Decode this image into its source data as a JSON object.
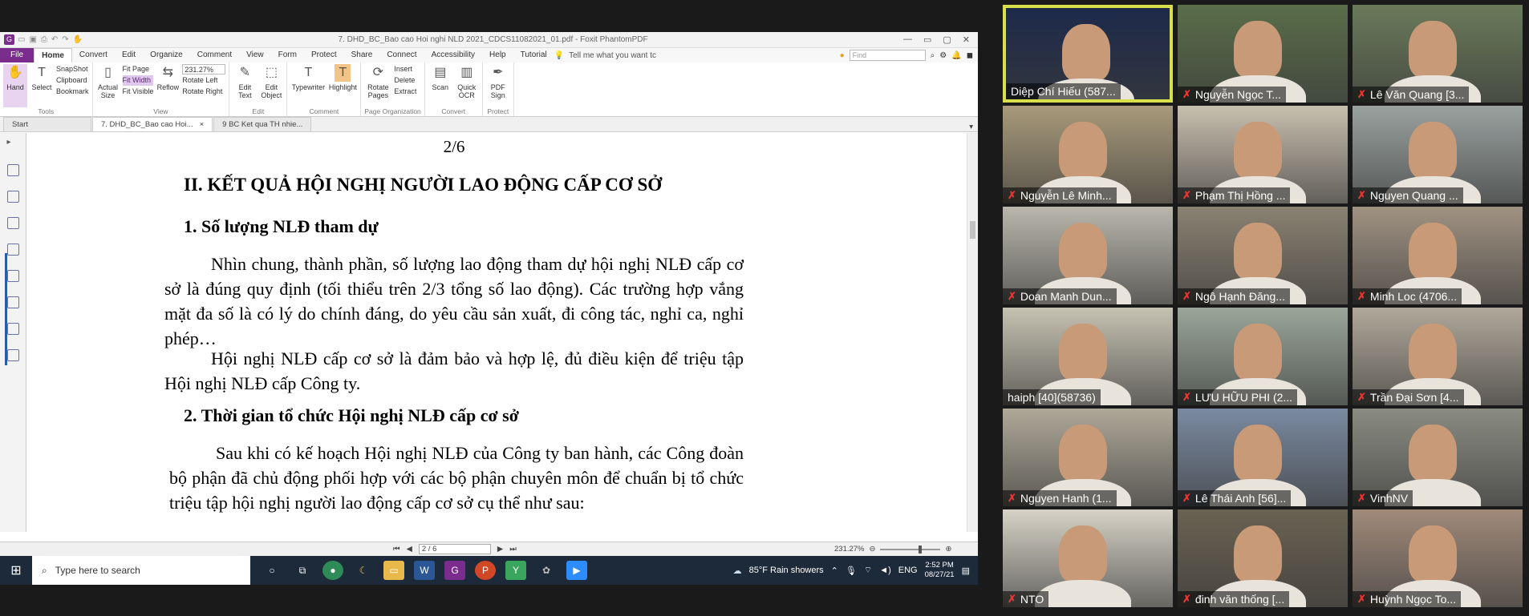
{
  "window": {
    "title": "7. DHD_BC_Bao cao Hoi nghi NLD 2021_CDCS11082021_01.pdf - Foxit PhantomPDF",
    "controls": [
      "—",
      "▭",
      "▢",
      "✕"
    ]
  },
  "menu": {
    "file": "File",
    "tabs": [
      "Home",
      "Convert",
      "Edit",
      "Organize",
      "Comment",
      "View",
      "Form",
      "Protect",
      "Share",
      "Connect",
      "Accessibility",
      "Help",
      "Tutorial"
    ],
    "tell_me": "Tell me what you want tc",
    "find_placeholder": "Find"
  },
  "ribbon": {
    "tools": {
      "label": "Tools",
      "hand": "Hand",
      "select": "Select",
      "snapshot": "SnapShot",
      "clipboard": "Clipboard",
      "bookmark": "Bookmark"
    },
    "view": {
      "label": "View",
      "actual_size": "Actual Size",
      "fit_page": "Fit Page",
      "fit_width": "Fit Width",
      "fit_visible": "Fit Visible",
      "reflow": "Reflow",
      "zoom": "231.27%",
      "rotate_left": "Rotate Left",
      "rotate_right": "Rotate Right"
    },
    "edit": {
      "label": "Edit",
      "edit_text": "Edit Text",
      "edit_object": "Edit Object"
    },
    "comment": {
      "label": "Comment",
      "typewriter": "Typewriter",
      "highlight": "Highlight"
    },
    "page_org": {
      "label": "Page Organization",
      "rotate_pages": "Rotate Pages",
      "insert": "Insert",
      "delete": "Delete",
      "extract": "Extract"
    },
    "convert": {
      "label": "Convert",
      "scan": "Scan",
      "quick_ocr": "Quick OCR"
    },
    "protect": {
      "label": "Protect",
      "pdf_sign": "PDF Sign"
    }
  },
  "doc_tabs": [
    {
      "label": "Start"
    },
    {
      "label": "7. DHD_BC_Bao cao Hoi...",
      "close": "×"
    },
    {
      "label": "9 BC Ket qua TH nhie..."
    }
  ],
  "document": {
    "page_number": "2/6",
    "heading": "II. KẾT QUẢ HỘI NGHỊ NGƯỜI LAO ĐỘNG CẤP CƠ SỞ",
    "sub1": "1.  Số lượng NLĐ tham dự",
    "p1": "Nhìn chung, thành phần, số lượng lao động tham dự hội nghị NLĐ cấp cơ sở là đúng quy định (tối thiểu trên 2/3 tổng số lao động). Các trường hợp vắng mặt đa số là có lý do chính đáng, do yêu cầu sản xuất, đi công tác, nghỉ ca, nghỉ phép…",
    "p2": "Hội nghị NLĐ cấp cơ sở là đảm bảo và hợp lệ, đủ điều kiện để triệu tập Hội nghị NLĐ cấp Công ty.",
    "sub2": "2. Thời gian tổ chức Hội nghị NLĐ cấp cơ sở",
    "p3": "Sau khi có kế hoạch Hội nghị NLĐ của Công ty ban hành, các Công đoàn bộ phận đã chủ động phối hợp với các bộ phận chuyên môn để chuẩn bị tổ chức triệu tập hội nghị người lao động cấp cơ sở cụ thể như sau:"
  },
  "status": {
    "page": "2 / 6",
    "zoom": "231.27%"
  },
  "taskbar": {
    "search_placeholder": "Type here to search",
    "weather": "85°F  Rain showers",
    "lang": "ENG",
    "time": "2:52 PM",
    "date": "08/27/21"
  },
  "participants": [
    {
      "name": "Diệp Chí Hiếu (587...",
      "muted": false,
      "speaking": true,
      "bg": "#1d2a4a"
    },
    {
      "name": "Nguyễn Ngọc T...",
      "muted": true,
      "speaking": false,
      "bg": "#5a6e4a"
    },
    {
      "name": "Lê Văn Quang [3...",
      "muted": true,
      "speaking": false,
      "bg": "#6a7a5a"
    },
    {
      "name": "Nguyễn Lê Minh...",
      "muted": true,
      "speaking": false,
      "bg": "#a89a7a"
    },
    {
      "name": "Phạm Thị Hồng ...",
      "muted": true,
      "speaking": false,
      "bg": "#c8bfae"
    },
    {
      "name": "Nguyen Quang ...",
      "muted": true,
      "speaking": false,
      "bg": "#9aa2a0"
    },
    {
      "name": "Doan Manh Dun...",
      "muted": true,
      "speaking": false,
      "bg": "#b9b7ac"
    },
    {
      "name": "Ngô Hạnh Đăng...",
      "muted": true,
      "speaking": false,
      "bg": "#8a8272"
    },
    {
      "name": "Minh Loc (4706...",
      "muted": true,
      "speaking": false,
      "bg": "#a09282"
    },
    {
      "name": "haiph [40](58736)",
      "muted": false,
      "speaking": false,
      "bg": "#c6c2b2"
    },
    {
      "name": "LƯU HỮU PHI (2...",
      "muted": true,
      "speaking": false,
      "bg": "#9aa69a"
    },
    {
      "name": "Trần Đại Sơn [4...",
      "muted": true,
      "speaking": false,
      "bg": "#b0a89a"
    },
    {
      "name": "Nguyen Hanh (1...",
      "muted": true,
      "speaking": false,
      "bg": "#aea898"
    },
    {
      "name": "Lê Thái Anh [56]...",
      "muted": true,
      "speaking": false,
      "bg": "#7a8aa0"
    },
    {
      "name": "VinhNV",
      "muted": true,
      "speaking": false,
      "bg": "#8a8c82"
    },
    {
      "name": "NTO",
      "muted": true,
      "speaking": false,
      "bg": "#d6d2c6"
    },
    {
      "name": "đinh văn thống [...",
      "muted": true,
      "speaking": false,
      "bg": "#6a6252"
    },
    {
      "name": "Huỳnh Ngọc To...",
      "muted": true,
      "speaking": false,
      "bg": "#a08a7a"
    }
  ]
}
